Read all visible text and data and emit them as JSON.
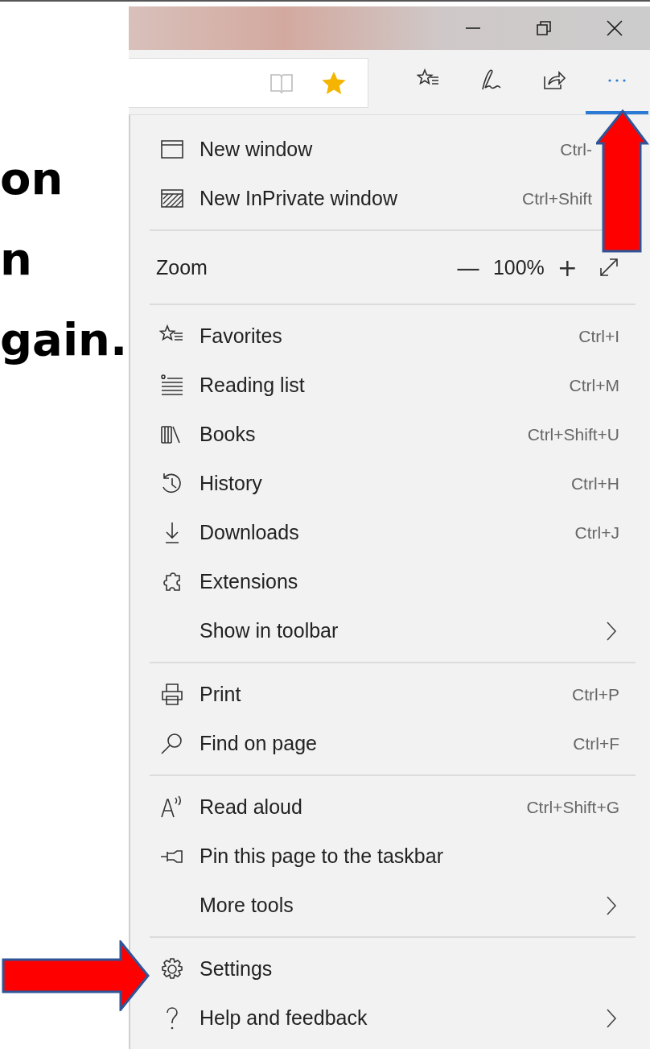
{
  "slide_text": [
    "on",
    "n",
    "gain."
  ],
  "toolbar": {
    "buttons": [
      {
        "kind": "favorites",
        "selected": false
      },
      {
        "kind": "notes",
        "selected": false
      },
      {
        "kind": "share",
        "selected": false
      },
      {
        "kind": "more",
        "selected": true
      }
    ]
  },
  "menu": {
    "sections": [
      {
        "items": [
          {
            "kind": "command",
            "label": "New window",
            "shortcut": "Ctrl-"
          },
          {
            "kind": "command",
            "label": "New InPrivate window",
            "shortcut": "Ctrl+Shift"
          }
        ]
      },
      {
        "items": [
          {
            "kind": "zoom",
            "label": "Zoom",
            "minus": "—",
            "value": "100%",
            "plus": "+"
          }
        ]
      },
      {
        "items": [
          {
            "kind": "command",
            "label": "Favorites",
            "shortcut": "Ctrl+I"
          },
          {
            "kind": "command",
            "label": "Reading list",
            "shortcut": "Ctrl+M"
          },
          {
            "kind": "command",
            "label": "Books",
            "shortcut": "Ctrl+Shift+U"
          },
          {
            "kind": "command",
            "label": "History",
            "shortcut": "Ctrl+H"
          },
          {
            "kind": "command",
            "label": "Downloads",
            "shortcut": "Ctrl+J"
          },
          {
            "kind": "command",
            "label": "Extensions"
          },
          {
            "kind": "submenu",
            "label": "Show in toolbar"
          }
        ]
      },
      {
        "items": [
          {
            "kind": "command",
            "label": "Print",
            "shortcut": "Ctrl+P"
          },
          {
            "kind": "command",
            "label": "Find on page",
            "shortcut": "Ctrl+F"
          }
        ]
      },
      {
        "items": [
          {
            "kind": "command",
            "label": "Read aloud",
            "shortcut": "Ctrl+Shift+G"
          },
          {
            "kind": "command",
            "label": "Pin this page to the taskbar"
          },
          {
            "kind": "submenu",
            "label": "More tools"
          }
        ]
      },
      {
        "items": [
          {
            "kind": "command",
            "label": "Settings"
          },
          {
            "kind": "submenu",
            "label": "Help and feedback"
          }
        ]
      }
    ]
  }
}
